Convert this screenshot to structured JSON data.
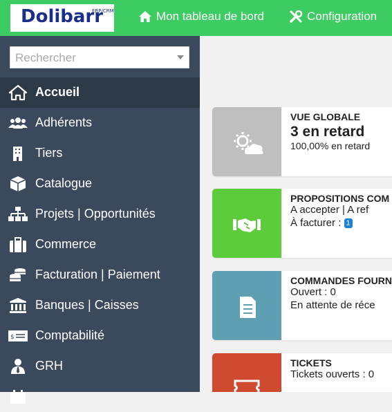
{
  "header": {
    "logo_text": "Dolibarr",
    "logo_sub": "ERP/CRM",
    "nav_home": "Mon tableau de bord",
    "nav_config": "Configuration"
  },
  "sidebar": {
    "search_placeholder": "Rechercher",
    "items": [
      {
        "label": "Accueil",
        "icon": "home-icon",
        "active": true
      },
      {
        "label": "Adhérents",
        "icon": "users-icon"
      },
      {
        "label": "Tiers",
        "icon": "building-icon"
      },
      {
        "label": "Catalogue",
        "icon": "cube-icon"
      },
      {
        "label": "Projets | Opportunités",
        "icon": "sitemap-icon"
      },
      {
        "label": "Commerce",
        "icon": "suitcase-icon"
      },
      {
        "label": "Facturation | Paiement",
        "icon": "coins-icon"
      },
      {
        "label": "Banques | Caisses",
        "icon": "bank-icon"
      },
      {
        "label": "Comptabilité",
        "icon": "money-check-icon"
      },
      {
        "label": "GRH",
        "icon": "user-tie-icon"
      }
    ]
  },
  "cards": [
    {
      "title": "VUE GLOBALE",
      "big": "3 en retard",
      "line1": "100,00% en retard",
      "icon": "weather-icon",
      "color": "#bfbfbf"
    },
    {
      "title": "PROPOSITIONS COM",
      "line1": "A accepter | A ref",
      "line2": "À facturer : ",
      "badge": "1",
      "icon": "handshake-icon",
      "color": "#5dcc3c"
    },
    {
      "title": "COMMANDES FOURN",
      "line1": "Ouvert : 0",
      "line2": "En attente de réce",
      "icon": "document-icon",
      "color": "#5f9fb2"
    },
    {
      "title": "TICKETS",
      "line1": "Tickets ouverts : 0",
      "icon": "ticket-icon",
      "color": "#d04a2f"
    }
  ]
}
